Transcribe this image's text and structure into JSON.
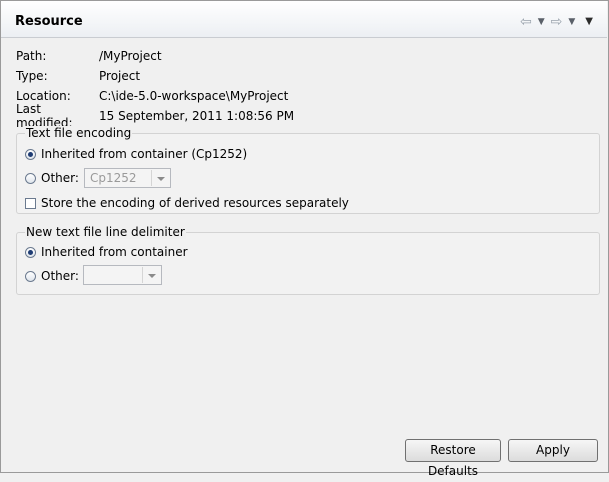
{
  "header": {
    "title": "Resource",
    "icons": [
      "back-arrow-icon",
      "dropdown-icon",
      "forward-arrow-icon",
      "dropdown-icon",
      "view-menu-icon"
    ]
  },
  "properties": [
    {
      "label": "Path:",
      "value": "/MyProject"
    },
    {
      "label": "Type:",
      "value": "Project"
    },
    {
      "label": "Location:",
      "value": "C:\\ide-5.0-workspace\\MyProject"
    },
    {
      "label": "Last modified:",
      "value": "15 September, 2011 1:08:56 PM"
    }
  ],
  "encoding": {
    "group_title": "Text file encoding",
    "inherited_label": "Inherited from container (Cp1252)",
    "inherited_selected": true,
    "other_label": "Other:",
    "other_value": "Cp1252",
    "store_label": "Store the encoding of derived resources separately",
    "store_checked": false
  },
  "delimiter": {
    "group_title": "New text file line delimiter",
    "inherited_label": "Inherited from container",
    "inherited_selected": true,
    "other_label": "Other:",
    "other_value": ""
  },
  "buttons": {
    "restore": "Restore Defaults",
    "apply": "Apply"
  }
}
